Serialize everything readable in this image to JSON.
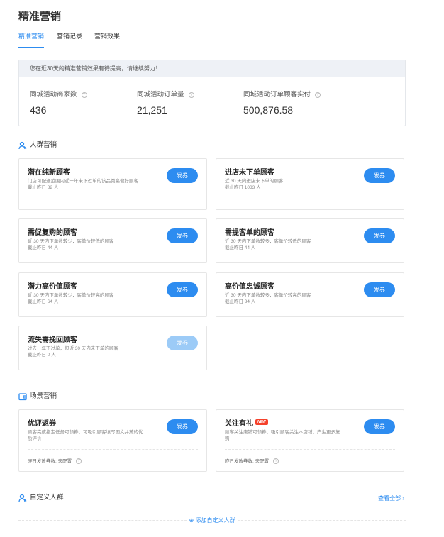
{
  "page": {
    "title": "精准营销"
  },
  "tabs": [
    {
      "label": "精准营销"
    },
    {
      "label": "营销记录"
    },
    {
      "label": "营销效果"
    }
  ],
  "stats": {
    "banner": "您在近30天的精准营销效果有待提高，请继续努力！",
    "items": [
      {
        "label": "同城活动商家数",
        "value": "436"
      },
      {
        "label": "同城活动订单量",
        "value": "21,251"
      },
      {
        "label": "同城活动订单顾客实付",
        "value": "500,876.58"
      }
    ]
  },
  "crowd": {
    "title": "人群营销",
    "cards": [
      {
        "title": "潜在纯新顾客",
        "desc": "门店可配送范围内近一年未下过单的该品类高偏好顾客",
        "sub": "截止昨日 82 人",
        "button": "发券"
      },
      {
        "title": "进店未下单顾客",
        "desc": "近 30 天内进店未下单的顾客",
        "sub": "截止昨日 1033 人",
        "button": "发券"
      },
      {
        "title": "需促复购的顾客",
        "desc": "近 30 天内下单数较少，客单价较低的顾客",
        "sub": "截止昨日 44 人",
        "button": "发券"
      },
      {
        "title": "需提客单的顾客",
        "desc": "近 30 天内下单数较多，客单价较低的顾客",
        "sub": "截止昨日 44 人",
        "button": "发券"
      },
      {
        "title": "潜力高价值顾客",
        "desc": "近 30 天内下单数较少，客单价较高的顾客",
        "sub": "截止昨日 64 人",
        "button": "发券"
      },
      {
        "title": "高价值忠诚顾客",
        "desc": "近 30 天内下单数较多，客单价较高的顾客",
        "sub": "截止昨日 34 人",
        "button": "发券"
      },
      {
        "title": "流失需挽回顾客",
        "desc": "过去一年下过单，但近 30 天内未下单的顾客",
        "sub": "截止昨日 0 人",
        "button": "发券"
      }
    ]
  },
  "scene": {
    "title": "场景营销",
    "cards": [
      {
        "title": "优评返券",
        "desc": "顾客完成指定任务可领券，可吸引顾客填写图文并茂的优质评价",
        "foot": "昨日发放券数: 未配置",
        "button": "发券"
      },
      {
        "title": "关注有礼",
        "badge": "NEW",
        "desc": "顾客关注店铺可领券，吸引顾客关注本店铺，产生更多复购",
        "foot": "昨日发放券数: 未配置",
        "button": "发券"
      }
    ]
  },
  "custom": {
    "title": "自定义人群",
    "view_all": "查看全部",
    "add": "添加自定义人群"
  },
  "colors": {
    "accent": "#2d8cf0",
    "badge": "#f5412b"
  }
}
